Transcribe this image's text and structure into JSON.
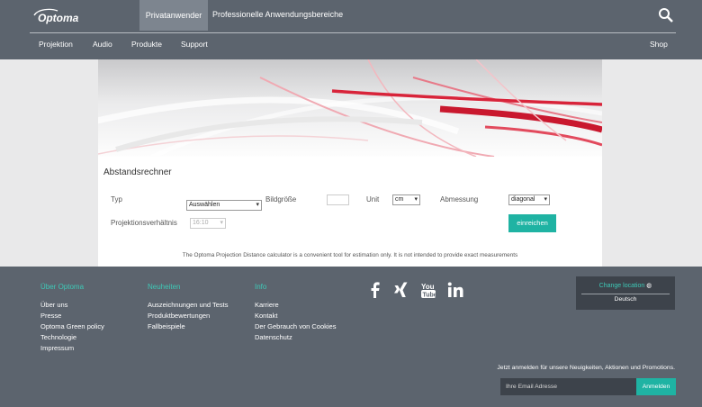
{
  "header": {
    "logo_text": "Optoma",
    "tab_active": "Privatanwender",
    "tab_other": "Professionelle Anwendungsbereiche",
    "nav": [
      "Projektion",
      "Audio",
      "Produkte",
      "Support"
    ],
    "shop": "Shop"
  },
  "calculator": {
    "title": "Abstandsrechner",
    "typ_label": "Typ",
    "typ_value": "Auswählen",
    "bildgroesse_label": "Bildgröße",
    "unit_label": "Unit",
    "unit_value": "cm",
    "abmessung_label": "Abmessung",
    "abmessung_value": "diagonal",
    "ratio_label": "Projektionsverhältnis",
    "ratio_value": "16:10",
    "submit": "einreichen",
    "note": "The Optoma Projection Distance calculator is a convenient tool for estimation only. It is not intended to provide exact measurements"
  },
  "footer": {
    "col1": {
      "heading": "Über Optoma",
      "links": [
        "Über uns",
        "Presse",
        "Optoma Green policy",
        "Technologie",
        "Impressum"
      ]
    },
    "col2": {
      "heading": "Neuheiten",
      "links": [
        "Auszeichnungen und Tests",
        "Produktbewertungen",
        "Fallbeispiele"
      ]
    },
    "col3": {
      "heading": "Info",
      "links": [
        "Karriere",
        "Kontakt",
        "Der Gebrauch von Cookies",
        "Datenschutz"
      ]
    },
    "social_icons": [
      "facebook-icon",
      "xing-icon",
      "youtube-icon",
      "linkedin-icon"
    ],
    "location": {
      "label": "Change location",
      "language": "Deutsch"
    },
    "newsletter_text": "Jetzt anmelden für unsere Neuigkeiten, Aktionen und Promotions.",
    "email_placeholder": "Ihre Email Adresse",
    "signup": "Anmelden"
  },
  "colors": {
    "header_bg": "#5c646e",
    "accent": "#1fb3a3",
    "accent_text": "#3ec9b7",
    "hero_red": "#d8243a"
  }
}
